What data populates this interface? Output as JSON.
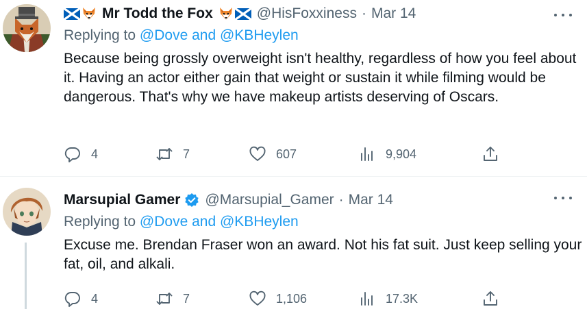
{
  "tweets": [
    {
      "display_name": "Mr Todd the Fox",
      "handle": "@HisFoxxiness",
      "separator": "·",
      "date": "Mar 14",
      "replying_prefix": "Replying to",
      "replying_user1": "@Dove",
      "replying_and": "and",
      "replying_user2": "@KBHeylen",
      "text": "Because being grossly overweight isn't healthy, regardless of how you feel about it.  Having an actor either gain that weight or sustain it while filming would be dangerous. That's why we have makeup artists deserving of Oscars.",
      "replies": "4",
      "retweets": "7",
      "likes": "607",
      "views": "9,904"
    },
    {
      "display_name": "Marsupial Gamer",
      "handle": "@Marsupial_Gamer",
      "separator": "·",
      "date": "Mar 14",
      "replying_prefix": "Replying to",
      "replying_user1": "@Dove",
      "replying_and": "and",
      "replying_user2": "@KBHeylen",
      "text": "Excuse me.  Brendan Fraser won an award.  Not his fat suit.  Just keep selling your fat, oil, and alkali.",
      "replies": "4",
      "retweets": "7",
      "likes": "1,106",
      "views": "17.3K"
    }
  ],
  "colors": {
    "text_primary": "#0f1419",
    "text_secondary": "#536471",
    "link": "#1d9bf0",
    "verified": "#1d9bf0",
    "divider": "#eff3f4",
    "thread_line": "#cfd9de"
  },
  "icons": [
    "scotland-flag-icon",
    "fox-emoji-icon",
    "verified-badge-icon",
    "more-options-icon",
    "reply-icon",
    "retweet-icon",
    "like-icon",
    "views-icon",
    "share-icon"
  ]
}
